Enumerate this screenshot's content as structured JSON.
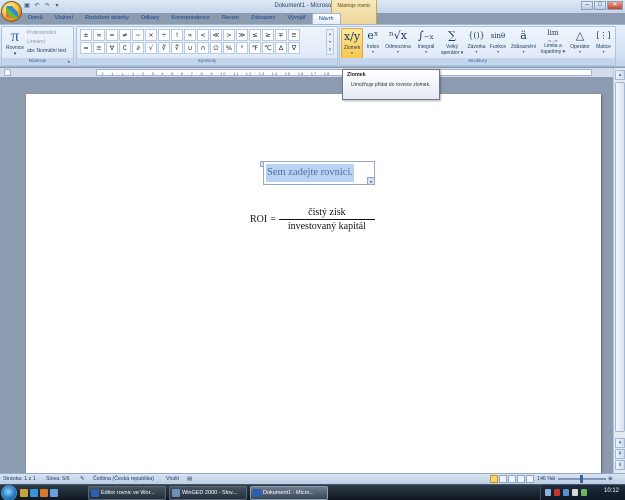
{
  "window": {
    "title": "Dokument1 - Microsoft Word",
    "contextual_tab_group": "Nástroje rovnic",
    "controls": [
      "–",
      "□",
      "✕"
    ]
  },
  "quick_access": {
    "icons": [
      "save-icon",
      "undo-icon",
      "redo-icon",
      "qat-customize-icon"
    ],
    "glyphs": [
      "▣",
      "↶",
      "↷",
      "▾"
    ]
  },
  "tabs": [
    "Domů",
    "Vložení",
    "Rozložení stránky",
    "Odkazy",
    "Korespondence",
    "Revize",
    "Zobrazení",
    "Vývojář",
    "Návrh"
  ],
  "active_tab": "Návrh",
  "tools": {
    "rovnice_glyph": "π",
    "rovnice_label": "Rovnice",
    "rovnice_arrow": "▾",
    "options": [
      "Profesionální",
      "Lineární",
      "abc Normální text"
    ],
    "group_label": "Nástroje"
  },
  "symbols": {
    "row1": [
      "±",
      "∞",
      "=",
      "≠",
      "~",
      "×",
      "÷",
      "!",
      "∝",
      "<",
      "≪",
      ">",
      "≫",
      "≤",
      "≥",
      "∓",
      "≅"
    ],
    "row2": [
      "≈",
      "≡",
      "∀",
      "∁",
      "∂",
      "√",
      "∛",
      "∜",
      "∪",
      "∩",
      "∅",
      "%",
      "°",
      "℉",
      "℃",
      "∆",
      "∇"
    ],
    "group_label": "Symboly"
  },
  "structures": {
    "buttons": [
      {
        "icon": "x/y",
        "label": "Zlomek"
      },
      {
        "icon": "eˣ",
        "label": "Index"
      },
      {
        "icon": "ⁿ√x",
        "label": "Odmocnina"
      },
      {
        "icon": "∫₋ₓ",
        "label": "Integrál"
      },
      {
        "icon": "∑",
        "label": "Velký operátor"
      },
      {
        "icon": "{()}",
        "label": "Závorka"
      },
      {
        "icon": "sinθ",
        "label": "Funkce"
      },
      {
        "icon": "ä",
        "label": "Zdůraznění"
      },
      {
        "icon": "lim",
        "label": "Limita a logaritmy"
      },
      {
        "icon": "△",
        "label": "Operátor"
      },
      {
        "icon": "[⋮]",
        "label": "Matice"
      }
    ],
    "velky_label_lines": [
      "Velký",
      "operátor ▾"
    ],
    "limita_label_lines": [
      "Limita a",
      "logaritmy ▾"
    ],
    "limita_sub": "n→∞",
    "group_label": "Struktury"
  },
  "tooltip": {
    "title": "Zlomek",
    "text": "Umožňuje přidat do rovnice zlomek."
  },
  "ruler": {
    "ticks": "· 2 · 1 · ⊥ · 1 · 2 · 3 · 4 · 5 · 6 · 7 · 8 · 9 · 10 · 11 · 12 · 13 · 14 · 15 · 16 · 17 · 18 ·"
  },
  "document": {
    "equation_placeholder": "Sem zadejte rovnici.",
    "formula": {
      "lhs": "ROI",
      "equals": "=",
      "numerator": "čistý zisk",
      "denominator": "investovaný kapitál"
    }
  },
  "statusbar": {
    "page": "Stránka: 1 z 1",
    "words": "Slova: 5/6",
    "language": "Čeština (Česká republika)",
    "mode": "Vložit",
    "zoom": "146 %",
    "zoom_minus": "⊖",
    "zoom_plus": "⊕"
  },
  "taskbar": {
    "tasks": [
      "Editor rovnic ve Wor...",
      "WinGED 2000 - Slov...",
      "Dokument1 - Micro..."
    ],
    "active_task": "Dokument1 - Micro...",
    "clock": "10:12"
  },
  "colors": {
    "ribbon": "#dce7f5",
    "zlomek_highlight": "#f8c64b",
    "contextual_tab": "#eed79a",
    "equation_selection": "#bad3f3"
  }
}
